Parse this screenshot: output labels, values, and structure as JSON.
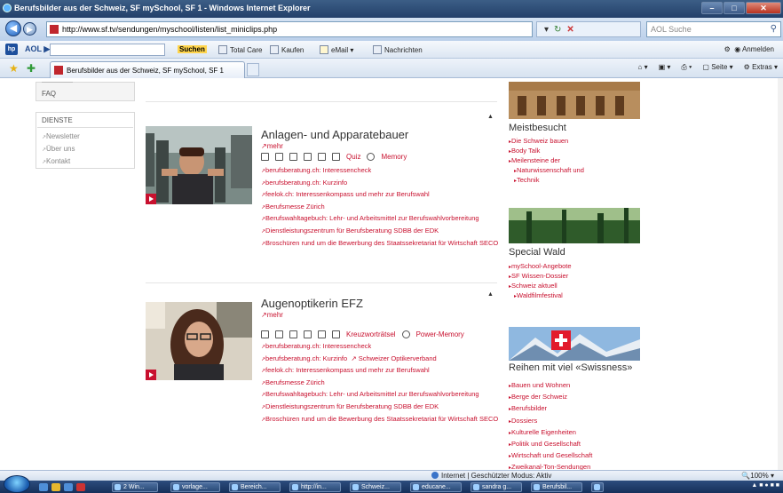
{
  "window": {
    "title": "Berufsbilder aus der Schweiz, SF mySchool, SF 1 - Windows Internet Explorer"
  },
  "address": {
    "url": "http://www.sf.tv/sendungen/myschool/listen/list_miniclips.php",
    "search_placeholder": "AOL Suche"
  },
  "aol_toolbar": {
    "logo": "AOL",
    "search_value": "",
    "suchen": "Suchen",
    "total_care": "Total Care",
    "kaufen": "Kaufen",
    "email": "eMail",
    "nachrichten": "Nachrichten",
    "anmelden": "Anmelden"
  },
  "tabbar": {
    "tab_title": "Berufsbilder aus der Schweiz, SF mySchool, SF 1",
    "seite": "Seite",
    "extras": "Extras"
  },
  "sidebar": {
    "faq": "FAQ",
    "dienste": "DIENSTE",
    "items": [
      "Newsletter",
      "Über uns",
      "Kontakt"
    ]
  },
  "clips": [
    {
      "title": "Anlagen- und Apparatebauer",
      "mehr": "mehr",
      "icon_labels": [
        "Quiz",
        "Memory"
      ],
      "links": [
        "berufsberatung.ch: Interessencheck",
        "berufsberatung.ch: Kurzinfo",
        "feelok.ch: Interessenkompass und mehr zur Berufswahl",
        "Berufsmesse Zürich",
        "Berufswahltagebuch: Lehr- und Arbeitsmittel zur Berufswahlvorbereitung",
        "Dienstleistungszentrum für Berufsberatung SDBB der EDK",
        "Broschüren rund um die Bewerbung des Staatssekretariat für Wirtschaft SECO"
      ]
    },
    {
      "title": "Augenoptikerin EFZ",
      "mehr": "mehr",
      "icon_labels": [
        "Kreuzworträtsel",
        "Power-Memory"
      ],
      "links": [
        "berufsberatung.ch: Interessencheck",
        "berufsberatung.ch: Kurzinfo",
        "Schweizer Optikerverband",
        "feelok.ch: Interessenkompass und mehr zur Berufswahl",
        "Berufsmesse Zürich",
        "Berufswahltagebuch: Lehr- und Arbeitsmittel zur Berufswahlvorbereitung",
        "Dienstleistungszentrum für Berufsberatung SDBB der EDK",
        "Broschüren rund um die Bewerbung des Staatssekretariat für Wirtschaft SECO"
      ]
    }
  ],
  "right": {
    "meist": {
      "title": "Meistbesucht",
      "links": [
        "Die Schweiz bauen",
        "Body Talk",
        "Meilensteine der",
        "Naturwissenschaft und",
        "Technik"
      ]
    },
    "wald": {
      "title": "Special Wald",
      "links": [
        "mySchool-Angebote",
        "SF Wissen-Dossier",
        "Schweiz aktuell",
        "Waldfilmfestival"
      ]
    },
    "swissness": {
      "title": "Reihen mit viel «Swissness»",
      "links": [
        "Bauen und Wohnen",
        "Berge der Schweiz",
        "Berufsbilder",
        "Dossiers",
        "Kulturelle Eigenheiten",
        "Politik und Gesellschaft",
        "Wirtschaft und Gesellschaft",
        "Zweikanal-Ton-Sendungen"
      ]
    }
  },
  "statusbar": {
    "zone": "Internet | Geschützter Modus: Aktiv",
    "zoom": "100%"
  },
  "taskbar": {
    "items": [
      "2 Win...",
      "vorlage...",
      "Bereich...",
      "http://in...",
      "Schweiz...",
      "educane...",
      "sandra g...",
      "Berufsbil..."
    ]
  },
  "colors": {
    "accent": "#c8102e",
    "ie_chrome": "#d5e3f3"
  }
}
